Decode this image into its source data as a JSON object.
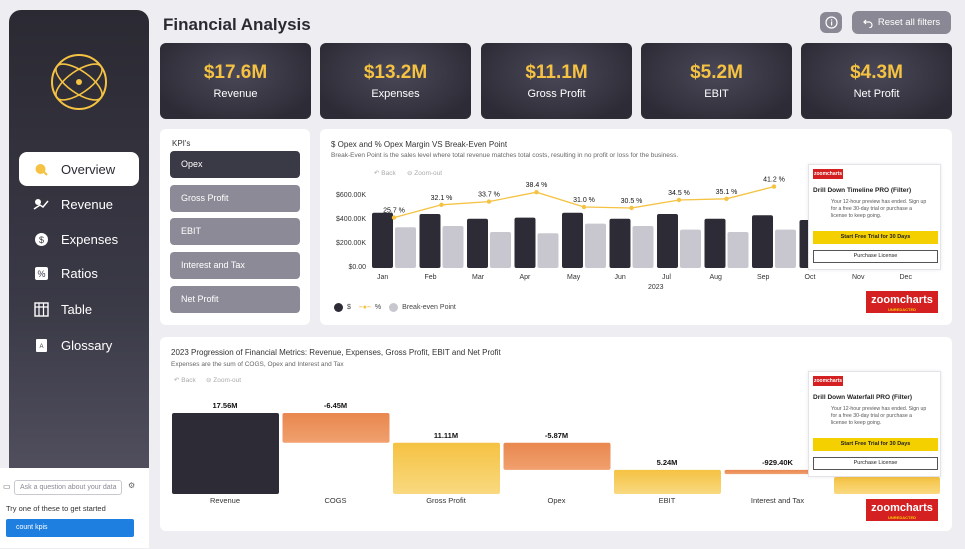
{
  "header": {
    "title": "Financial Analysis",
    "reset_label": "Reset all filters"
  },
  "kpis": [
    {
      "value": "$17.6M",
      "label": "Revenue"
    },
    {
      "value": "$13.2M",
      "label": "Expenses"
    },
    {
      "value": "$11.1M",
      "label": "Gross Profit"
    },
    {
      "value": "$5.2M",
      "label": "EBIT"
    },
    {
      "value": "$4.3M",
      "label": "Net Profit"
    }
  ],
  "sidebar": {
    "items": [
      {
        "label": "Overview",
        "icon": "overview-icon",
        "active": true
      },
      {
        "label": "Revenue",
        "icon": "revenue-icon"
      },
      {
        "label": "Expenses",
        "icon": "dollar-icon"
      },
      {
        "label": "Ratios",
        "icon": "percent-icon"
      },
      {
        "label": "Table",
        "icon": "table-icon"
      },
      {
        "label": "Glossary",
        "icon": "glossary-icon"
      }
    ]
  },
  "qa": {
    "placeholder": "Ask a question about your data",
    "hint": "Try one of these to get started",
    "suggestion": "count kpis"
  },
  "kpi_selector": {
    "title": "KPI's",
    "options": [
      "Opex",
      "Gross Profit",
      "EBIT",
      "Interest and Tax",
      "Net Profit"
    ],
    "selected": "Opex"
  },
  "colors": {
    "dark": "#2d2c36",
    "accent": "#f5c242",
    "orange": "#e9874f",
    "gray_button": "#8c8a96"
  },
  "combo_chart": {
    "title": "$ Opex and % Opex Margin VS Break-Even Point",
    "subtitle": "Break-Even Point is the sales level where total revenue matches total costs, resulting in no profit or loss for the business.",
    "back": "Back",
    "zoom_out": "Zoom-out",
    "y_ticks": [
      "$600.00K",
      "$400.00K",
      "$200.00K",
      "$0.00"
    ],
    "year": "2023",
    "legend": [
      "$",
      "%",
      "Break-even Point"
    ]
  },
  "waterfall_chart": {
    "title": "2023 Progression of Financial Metrics: Revenue, Expenses, Gross Profit, EBIT and Net Profit",
    "subtitle": "Expenses are the sum of COGS, Opex and Interest and Tax",
    "back": "Back",
    "zoom_out": "Zoom-out"
  },
  "trial_top": {
    "title": "Drill Down Timeline PRO (Filter)",
    "message": "Your 12-hour preview has ended. Sign up for a free 30-day trial or purchase a license to keep going.",
    "cta": "Start Free Trial for 30 Days",
    "license": "Purchase License",
    "badge": "zoomcharts",
    "logo": "zoomcharts",
    "logo_sub": "UNREDACTED"
  },
  "trial_bottom": {
    "title": "Drill Down Waterfall PRO (Filter)",
    "message": "Your 12-hour preview has ended. Sign up for a free 30-day trial or purchase a license to keep going.",
    "cta": "Start Free Trial for 30 Days",
    "license": "Purchase License",
    "badge": "zoomcharts",
    "logo": "zoomcharts",
    "logo_sub": "UNREDACTED"
  },
  "chart_data": [
    {
      "type": "bar",
      "title": "$ Opex and % Opex Margin VS Break-Even Point",
      "categories": [
        "Jan",
        "Feb",
        "Mar",
        "Apr",
        "May",
        "Jun",
        "Jul",
        "Aug",
        "Sep",
        "Oct",
        "Nov",
        "Dec"
      ],
      "ylim": [
        0,
        600000
      ],
      "series": [
        {
          "name": "$",
          "kind": "bar",
          "values": [
            460000,
            450000,
            410000,
            420000,
            460000,
            410000,
            450000,
            410000,
            440000,
            400000,
            null,
            null
          ]
        },
        {
          "name": "Break-even Point",
          "kind": "bar",
          "values": [
            340000,
            350000,
            300000,
            290000,
            370000,
            350000,
            320000,
            300000,
            320000,
            310000,
            null,
            null
          ]
        },
        {
          "name": "%",
          "kind": "line",
          "values": [
            25.7,
            32.1,
            33.7,
            38.4,
            31.0,
            30.5,
            34.5,
            35.1,
            41.2,
            null,
            null,
            null
          ],
          "labels": [
            "25.7 %",
            "32.1 %",
            "33.7 %",
            "38.4 %",
            "31.0 %",
            "30.5 %",
            "34.5 %",
            "35.1 %",
            "41.2 %"
          ]
        }
      ]
    },
    {
      "type": "bar",
      "title": "2023 Progression of Financial Metrics: Revenue, Expenses, Gross Profit, EBIT and Net Profit",
      "categories": [
        "Revenue",
        "COGS",
        "Gross Profit",
        "Opex",
        "EBIT",
        "Interest and Tax"
      ],
      "values": [
        17.56,
        -6.45,
        11.11,
        -5.87,
        5.24,
        -0.9294
      ],
      "labels": [
        "17.56M",
        "-6.45M",
        "11.11M",
        "-5.87M",
        "5.24M",
        "-929.40K"
      ],
      "units": "M"
    }
  ]
}
